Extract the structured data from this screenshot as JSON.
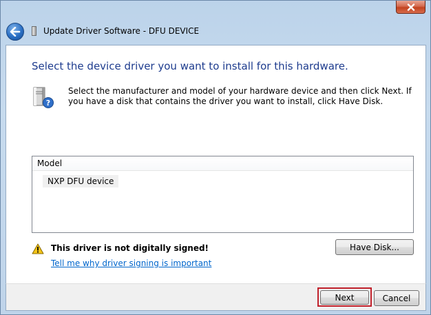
{
  "window": {
    "title": "Update Driver Software - DFU DEVICE",
    "close_label": "✕"
  },
  "page": {
    "heading": "Select the device driver you want to install for this hardware.",
    "instructions": "Select the manufacturer and model of your hardware device and then click Next. If you have a disk that contains the driver you want to install, click Have Disk."
  },
  "model_list": {
    "header": "Model",
    "items": [
      "NXP DFU device"
    ]
  },
  "warning": {
    "text": "This driver is not digitally signed!",
    "link": "Tell me why driver signing is important"
  },
  "buttons": {
    "have_disk": "Have Disk...",
    "next": "Next",
    "cancel": "Cancel"
  },
  "colors": {
    "heading": "#1e3c8e",
    "link": "#0066cc",
    "highlight": "#c0202a"
  },
  "icons": {
    "back": "back-arrow-icon",
    "title": "device-icon",
    "hardware": "hardware-question-icon",
    "warning": "warning-icon",
    "close": "close-icon"
  }
}
